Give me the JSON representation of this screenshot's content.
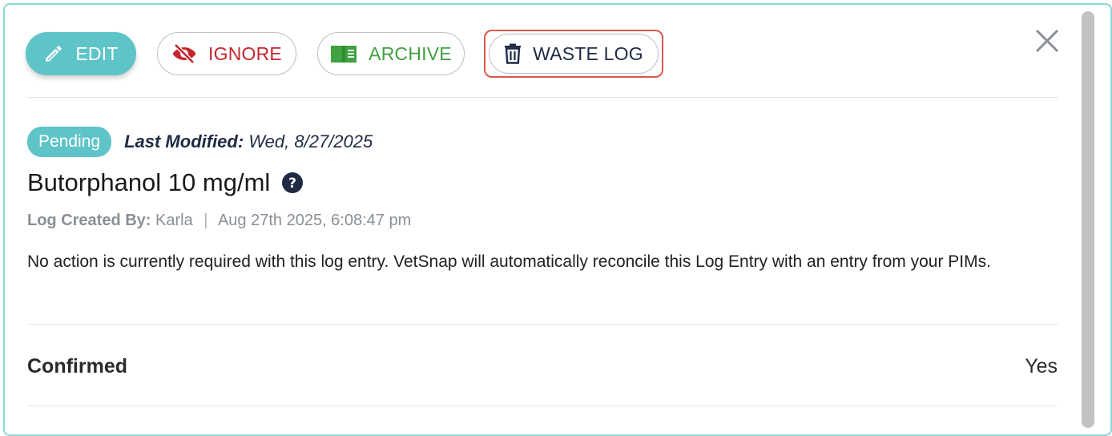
{
  "toolbar": {
    "edit_label": "EDIT",
    "ignore_label": "IGNORE",
    "archive_label": "ARCHIVE",
    "waste_label": "WASTE LOG"
  },
  "icons": {
    "edit": "pencil-icon",
    "ignore": "eye-slash-icon",
    "archive": "open-book-icon",
    "waste": "trash-icon",
    "close": "close-icon",
    "help": "question-circle-icon"
  },
  "colors": {
    "accent": "#5ec4c8",
    "ignore": "#c4262e",
    "archive": "#3fa140",
    "highlight": "#d9584c",
    "navy": "#1f2a44"
  },
  "status": {
    "badge": "Pending",
    "modified_label": "Last Modified:",
    "modified_value": "Wed, 8/27/2025"
  },
  "item": {
    "title": "Butorphanol 10 mg/ml",
    "created_label": "Log Created By:",
    "created_by": "Karla",
    "separator": "|",
    "created_at": "Aug 27th 2025, 6:08:47 pm",
    "message": "No action is currently required with this log entry. VetSnap will automatically reconcile this Log Entry with an entry from your PIMs."
  },
  "fields": {
    "confirmed_label": "Confirmed",
    "confirmed_value": "Yes"
  }
}
